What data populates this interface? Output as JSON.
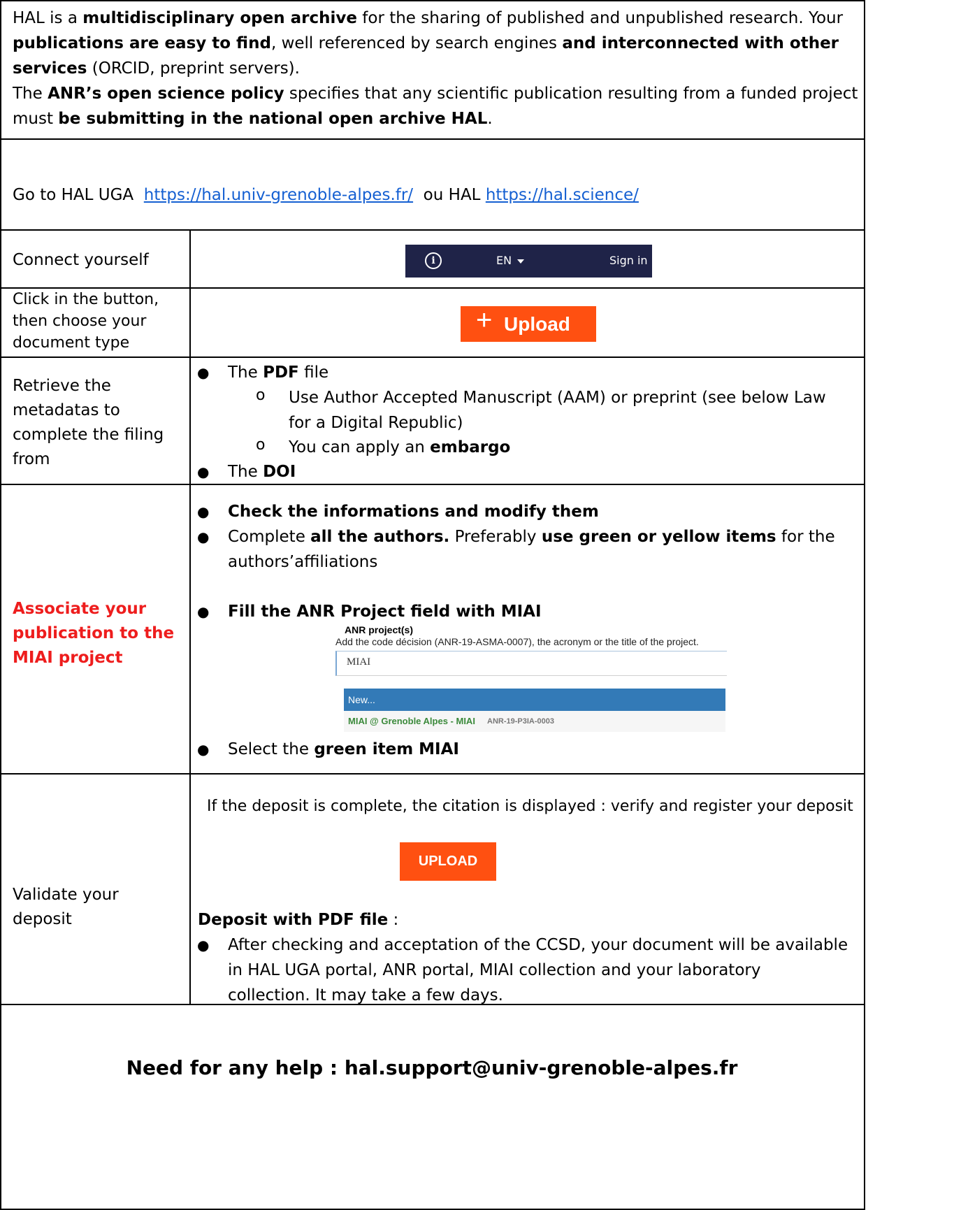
{
  "intro": {
    "l1_a": "HAL is a ",
    "l1_b": "multidisciplinary open archive",
    "l1_c": " for the sharing of published and unpublished research. Your",
    "l2_a": "publications are easy to find",
    "l2_b": ", well referenced by search engines ",
    "l2_c": "and interconnected with other",
    "l3_a": "services",
    "l3_b": " (ORCID, preprint servers).",
    "l4_a": "The ",
    "l4_b": "ANR’s open science policy",
    "l4_c": " specifies that any scientific publication resulting from a funded project",
    "l5_a": "must ",
    "l5_b": "be submitting in the national open archive HAL",
    "l5_c": "."
  },
  "goto": {
    "prefix": "Go to HAL UGA  ",
    "link1": "https://hal.univ-grenoble-alpes.fr/",
    "mid": "  ou HAL ",
    "link2": "https://hal.science/"
  },
  "rows": {
    "connect_label": "Connect yourself",
    "navbar": {
      "info": "i",
      "lang": "EN",
      "signin": "Sign in"
    },
    "click_l1": "Click in the button,",
    "click_l2": "then choose your",
    "click_l3": "document type",
    "upload_plus": "+",
    "upload_label": "Upload",
    "retrieve_l1": "Retrieve the",
    "retrieve_l2": "metadatas to",
    "retrieve_l3": "complete the filing",
    "retrieve_l4": "from",
    "pdf_a": "The ",
    "pdf_b": "PDF",
    "pdf_c": " file",
    "sub1_l1": "Use Author Accepted Manuscript (AAM) or preprint (see below Law",
    "sub1_l2": "for a Digital Republic)",
    "sub2_a": "You can apply an ",
    "sub2_b": "embargo",
    "doi_a": "The ",
    "doi_b": "DOI",
    "assoc_l1": "Associate your",
    "assoc_l2": "publication to the",
    "assoc_l3": "MIAI project",
    "check": "Check the informations and modify them",
    "complete_a": "Complete ",
    "complete_b": "all the authors.",
    "complete_c": " Preferably ",
    "complete_d": "use green or yellow items",
    "complete_e": " for the",
    "complete_l2": "authors’affiliations",
    "fill": "Fill the ANR Project field with MIAI",
    "anr_title": "ANR project(s)",
    "anr_hint": "Add the code décision (ANR-19-ASMA-0007), the acronym or the title of the project.",
    "anr_value": "MIAI",
    "anr_new": "New...",
    "anr_miai": "MIAI @ Grenoble Alpes - MIAI",
    "anr_code": "ANR-19-P3IA-0003",
    "select_a": "Select the ",
    "select_b": "green item MIAI",
    "validate_l1": "Validate your",
    "validate_l2": "deposit",
    "deposit_complete": "If the deposit is complete, the citation is displayed : verify and register your deposit",
    "upload2": "UPLOAD",
    "deposit_pdf_a": "Deposit with PDF file",
    "deposit_pdf_b": " :",
    "after_l1": "After checking and acceptation of the CCSD, your document will be available",
    "after_l2": "in HAL UGA portal, ANR portal, MIAI collection and your laboratory",
    "after_l3": "collection. It may take a few days."
  },
  "help": "Need for any help : hal.support@univ-grenoble-alpes.fr",
  "colors": {
    "accent_red": "#ee1d1d",
    "upload_orange": "#ff5011",
    "navbar": "#1f2348",
    "link": "#1560d2"
  }
}
